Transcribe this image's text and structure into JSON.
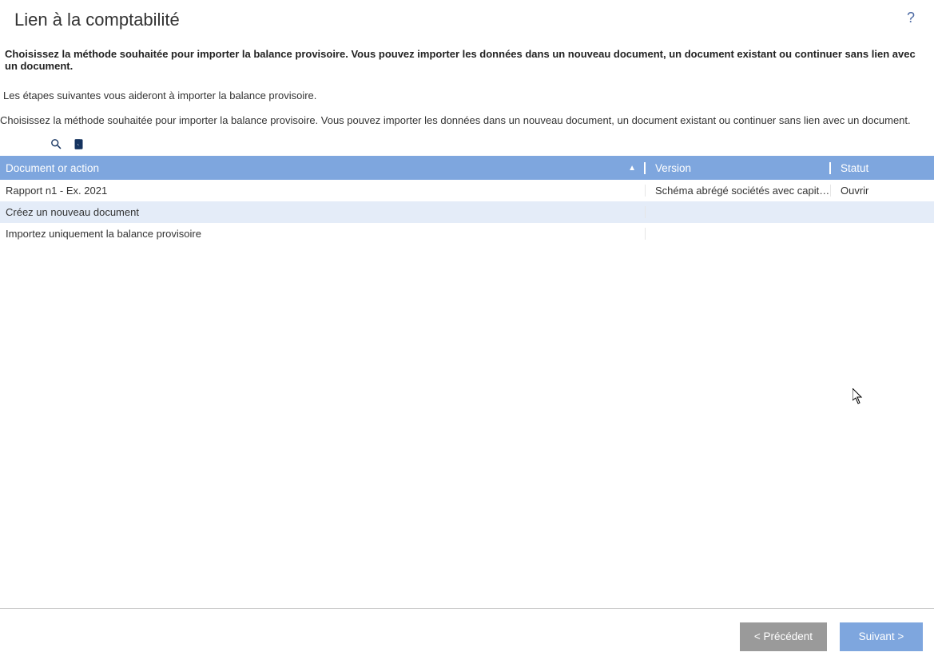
{
  "header": {
    "title": "Lien à la comptabilité",
    "help": "?"
  },
  "descriptions": {
    "bold": "Choisissez la méthode souhaitée pour importer la balance provisoire. Vous pouvez importer les données dans un nouveau document, un document existant ou continuer sans lien avec un document.",
    "line1": "Les étapes suivantes vous aideront à importer la balance provisoire.",
    "line2": "Choisissez la méthode souhaitée pour importer la balance provisoire. Vous pouvez importer les données dans un nouveau document, un document existant ou continuer sans lien avec un document."
  },
  "table": {
    "headers": {
      "doc": "Document or action",
      "version": "Version",
      "statut": "Statut"
    },
    "rows": [
      {
        "doc": "Rapport n1 - Ex. 2021",
        "version": "Schéma abrégé sociétés avec capit…",
        "statut": "Ouvrir"
      },
      {
        "doc": "Créez un nouveau document",
        "version": "",
        "statut": ""
      },
      {
        "doc": "Importez uniquement la balance provisoire",
        "version": "",
        "statut": ""
      }
    ]
  },
  "footer": {
    "prev": "< Précédent",
    "next": "Suivant >"
  }
}
